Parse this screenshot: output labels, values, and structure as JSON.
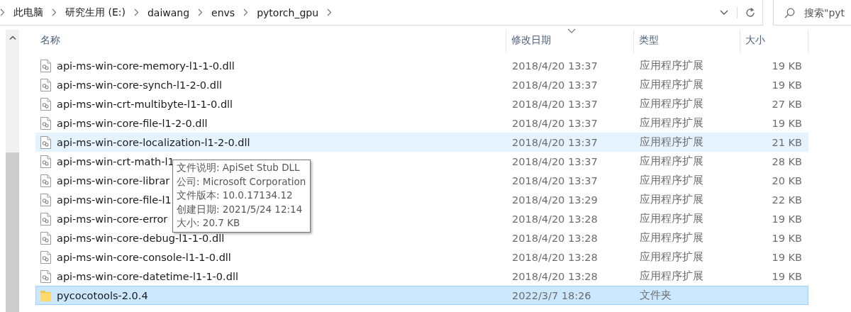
{
  "address_bar": {
    "breadcrumbs": [
      "此电脑",
      "研究生用 (E:)",
      "daiwang",
      "envs",
      "pytorch_gpu"
    ]
  },
  "search": {
    "placeholder": "搜索\"pyt"
  },
  "columns": [
    {
      "label": "名称",
      "sorted": false
    },
    {
      "label": "修改日期",
      "sorted": true
    },
    {
      "label": "类型",
      "sorted": false
    },
    {
      "label": "大小",
      "sorted": false
    }
  ],
  "rows": [
    {
      "kind": "file",
      "name": "api-ms-win-core-memory-l1-1-0.dll",
      "date": "2018/4/20 13:37",
      "type": "应用程序扩展",
      "size": "19 KB",
      "hovered": false,
      "selected": false
    },
    {
      "kind": "file",
      "name": "api-ms-win-core-synch-l1-2-0.dll",
      "date": "2018/4/20 13:37",
      "type": "应用程序扩展",
      "size": "19 KB",
      "hovered": false,
      "selected": false
    },
    {
      "kind": "file",
      "name": "api-ms-win-crt-multibyte-l1-1-0.dll",
      "date": "2018/4/20 13:37",
      "type": "应用程序扩展",
      "size": "27 KB",
      "hovered": false,
      "selected": false
    },
    {
      "kind": "file",
      "name": "api-ms-win-core-file-l1-2-0.dll",
      "date": "2018/4/20 13:37",
      "type": "应用程序扩展",
      "size": "19 KB",
      "hovered": false,
      "selected": false
    },
    {
      "kind": "file",
      "name": "api-ms-win-core-localization-l1-2-0.dll",
      "date": "2018/4/20 13:37",
      "type": "应用程序扩展",
      "size": "21 KB",
      "hovered": true,
      "selected": false
    },
    {
      "kind": "file",
      "name": "api-ms-win-crt-math-l1",
      "date": "2018/4/20 13:37",
      "type": "应用程序扩展",
      "size": "28 KB",
      "hovered": false,
      "selected": false
    },
    {
      "kind": "file",
      "name": "api-ms-win-core-librar",
      "date": "2018/4/20 13:37",
      "type": "应用程序扩展",
      "size": "20 KB",
      "hovered": false,
      "selected": false
    },
    {
      "kind": "file",
      "name": "api-ms-win-core-file-l1",
      "date": "2018/4/20 13:29",
      "type": "应用程序扩展",
      "size": "22 KB",
      "hovered": false,
      "selected": false
    },
    {
      "kind": "file",
      "name": "api-ms-win-core-error",
      "date": "2018/4/20 13:28",
      "type": "应用程序扩展",
      "size": "19 KB",
      "hovered": false,
      "selected": false
    },
    {
      "kind": "file",
      "name": "api-ms-win-core-debug-l1-1-0.dll",
      "date": "2018/4/20 13:28",
      "type": "应用程序扩展",
      "size": "19 KB",
      "hovered": false,
      "selected": false
    },
    {
      "kind": "file",
      "name": "api-ms-win-core-console-l1-1-0.dll",
      "date": "2018/4/20 13:28",
      "type": "应用程序扩展",
      "size": "19 KB",
      "hovered": false,
      "selected": false
    },
    {
      "kind": "file",
      "name": "api-ms-win-core-datetime-l1-1-0.dll",
      "date": "2018/4/20 13:28",
      "type": "应用程序扩展",
      "size": "19 KB",
      "hovered": false,
      "selected": false
    },
    {
      "kind": "folder",
      "name": "pycocotools-2.0.4",
      "date": "2022/3/7 18:26",
      "type": "文件夹",
      "size": "",
      "hovered": false,
      "selected": true
    }
  ],
  "tooltip": {
    "lines": [
      "文件说明: ApiSet Stub DLL",
      "公司: Microsoft Corporation",
      "文件版本: 10.0.17134.12",
      "创建日期: 2021/5/24 12:14",
      "大小: 20.7 KB"
    ]
  }
}
